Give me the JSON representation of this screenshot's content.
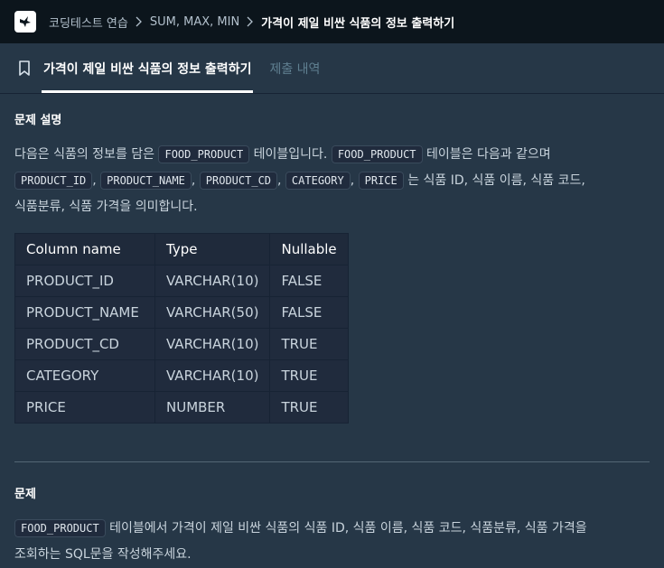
{
  "header": {
    "breadcrumb": [
      "코딩테스트 연습",
      "SUM, MAX, MIN",
      "가격이 제일 비싼 식품의 정보 출력하기"
    ]
  },
  "tabs": [
    {
      "label": "가격이 제일 비싼 식품의 정보 출력하기",
      "active": true
    },
    {
      "label": "제출 내역",
      "active": false
    }
  ],
  "description": {
    "title": "문제 설명",
    "p1": "다음은 식품의 정보를 담은",
    "code1": "FOOD_PRODUCT",
    "p2": "테이블입니다.",
    "code2": "FOOD_PRODUCT",
    "p3": "테이블은 다음과 같으며",
    "cols": [
      "PRODUCT_ID",
      "PRODUCT_NAME",
      "PRODUCT_CD",
      "CATEGORY",
      "PRICE"
    ],
    "sep": ",",
    "p4": "는 식품 ID, 식품 이름, 식품 코드,",
    "p5": "식품분류, 식품 가격을 의미합니다."
  },
  "table": {
    "headers": [
      "Column name",
      "Type",
      "Nullable"
    ],
    "rows": [
      [
        "PRODUCT_ID",
        "VARCHAR(10)",
        "FALSE"
      ],
      [
        "PRODUCT_NAME",
        "VARCHAR(50)",
        "FALSE"
      ],
      [
        "PRODUCT_CD",
        "VARCHAR(10)",
        "TRUE"
      ],
      [
        "CATEGORY",
        "VARCHAR(10)",
        "TRUE"
      ],
      [
        "PRICE",
        "NUMBER",
        "TRUE"
      ]
    ]
  },
  "problem": {
    "title": "문제",
    "code": "FOOD_PRODUCT",
    "text1": "테이블에서 가격이 제일 비싼 식품의 식품 ID, 식품 이름, 식품 코드, 식품분류, 식품 가격을",
    "text2": "조회하는 SQL문을 작성해주세요."
  }
}
